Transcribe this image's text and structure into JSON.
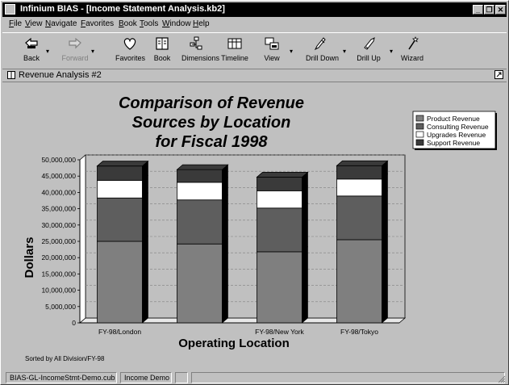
{
  "window": {
    "title": "Infinium BIAS - [Income Statement Analysis.kb2]",
    "controls": {
      "minimize": "_",
      "restore": "❐",
      "close": "✕"
    }
  },
  "menu": [
    "File",
    "View",
    "Navigate",
    "Favorites",
    "Book",
    "Tools",
    "Window",
    "Help"
  ],
  "toolbar": [
    {
      "label": "Back",
      "icon": "back-arrow-icon",
      "enabled": true
    },
    {
      "label": "Forward",
      "icon": "forward-arrow-icon",
      "enabled": false
    },
    {
      "label": "Favorites",
      "icon": "heart-icon",
      "enabled": true
    },
    {
      "label": "Book",
      "icon": "book-icon",
      "enabled": true
    },
    {
      "label": "Dimensions",
      "icon": "dimensions-icon",
      "enabled": true
    },
    {
      "label": "Timeline",
      "icon": "timeline-icon",
      "enabled": true
    },
    {
      "label": "View",
      "icon": "view-icon",
      "enabled": true
    },
    {
      "label": "Drill Down",
      "icon": "drill-down-icon",
      "enabled": true
    },
    {
      "label": "Drill Up",
      "icon": "drill-up-icon",
      "enabled": true
    },
    {
      "label": "Wizard",
      "icon": "wizard-icon",
      "enabled": true
    }
  ],
  "document": {
    "title": "Revenue Analysis #2"
  },
  "chart_data": {
    "type": "bar",
    "stacked": true,
    "title": "Comparison of Revenue Sources by Location for Fiscal 1998",
    "title_lines": [
      "Comparison of Revenue",
      "Sources by Location",
      "for Fiscal 1998"
    ],
    "xlabel": "Operating Location",
    "ylabel": "Dollars",
    "ylim": [
      0,
      50000000
    ],
    "yticks": [
      "0",
      "5,000,000",
      "10,000,000",
      "15,000,000",
      "20,000,000",
      "25,000,000",
      "30,000,000",
      "35,000,000",
      "40,000,000",
      "45,000,000",
      "50,000,000"
    ],
    "categories": [
      "FY-98/London",
      "",
      "FY-98/New York",
      "FY-98/Tokyo"
    ],
    "series": [
      {
        "name": "Product Revenue",
        "color": "#7f7f7f",
        "values": [
          25000000,
          24200000,
          21800000,
          25500000
        ]
      },
      {
        "name": "Consulting Revenue",
        "color": "#5e5e5e",
        "values": [
          13300000,
          13500000,
          13400000,
          13400000
        ]
      },
      {
        "name": "Upgrades Revenue",
        "color": "#ffffff",
        "values": [
          5400000,
          5400000,
          5300000,
          5200000
        ]
      },
      {
        "name": "Support Revenue",
        "color": "#3a3a3a",
        "values": [
          4400000,
          3900000,
          4200000,
          4100000
        ]
      }
    ],
    "legend_position": "top-right",
    "grid": true,
    "footnote": "Sorted by All Division/FY-98"
  },
  "status": [
    "BIAS-GL-IncomeStmt-Demo.cub",
    "Income Demo",
    ""
  ]
}
